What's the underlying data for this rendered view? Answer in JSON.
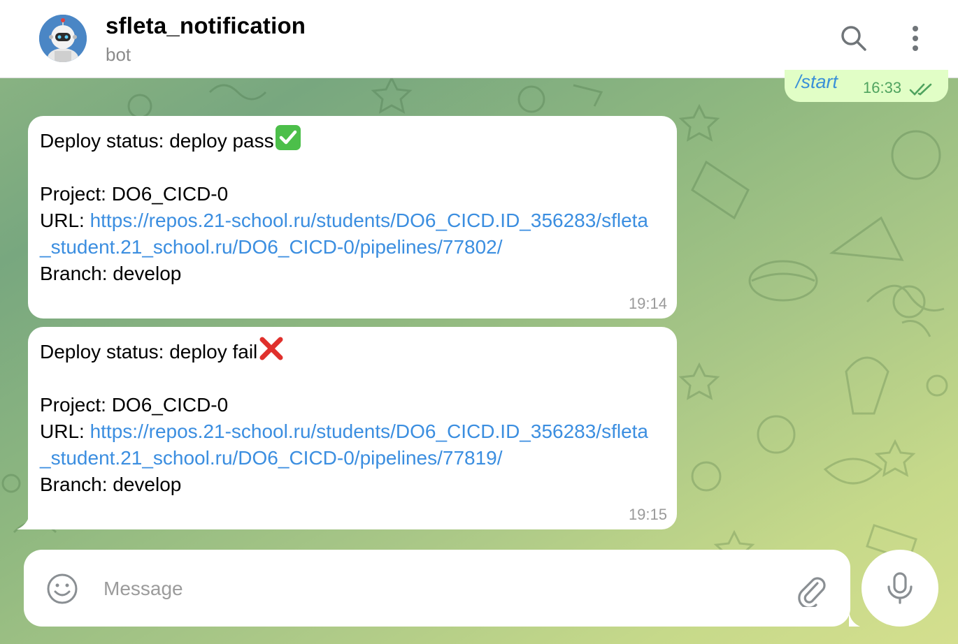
{
  "header": {
    "title": "sfleta_notification",
    "subtitle": "bot",
    "avatar_icon": "robot-icon",
    "search_icon": "search-icon",
    "menu_icon": "more-vertical-icon"
  },
  "outgoing": {
    "text": "/start",
    "time": "16:33",
    "status_icon": "double-check-icon"
  },
  "messages": [
    {
      "status_line": "Deploy status: deploy pass",
      "status_emoji": "check-mark-button-icon",
      "project": "Project: DO6_CICD-0",
      "url_label": "URL: ",
      "url": "https://repos.21-school.ru/students/DO6_CICD.ID_356283/sfleta_student.21_school.ru/DO6_CICD-0/pipelines/77802/",
      "branch": "Branch: develop",
      "time": "19:14"
    },
    {
      "status_line": "Deploy status: deploy fail",
      "status_emoji": "cross-mark-icon",
      "project": "Project: DO6_CICD-0",
      "url_label": "URL: ",
      "url": "https://repos.21-school.ru/students/DO6_CICD.ID_356283/sfleta_student.21_school.ru/DO6_CICD-0/pipelines/77819/",
      "branch": "Branch: develop",
      "time": "19:15"
    }
  ],
  "composer": {
    "placeholder": "Message",
    "value": "",
    "emoji_icon": "smiley-icon",
    "attach_icon": "paperclip-icon",
    "mic_icon": "microphone-icon"
  },
  "colors": {
    "outgoing_bubble": "#e1fec6",
    "link": "#3b8ee0",
    "avatar_bg": "#4a86c5"
  }
}
